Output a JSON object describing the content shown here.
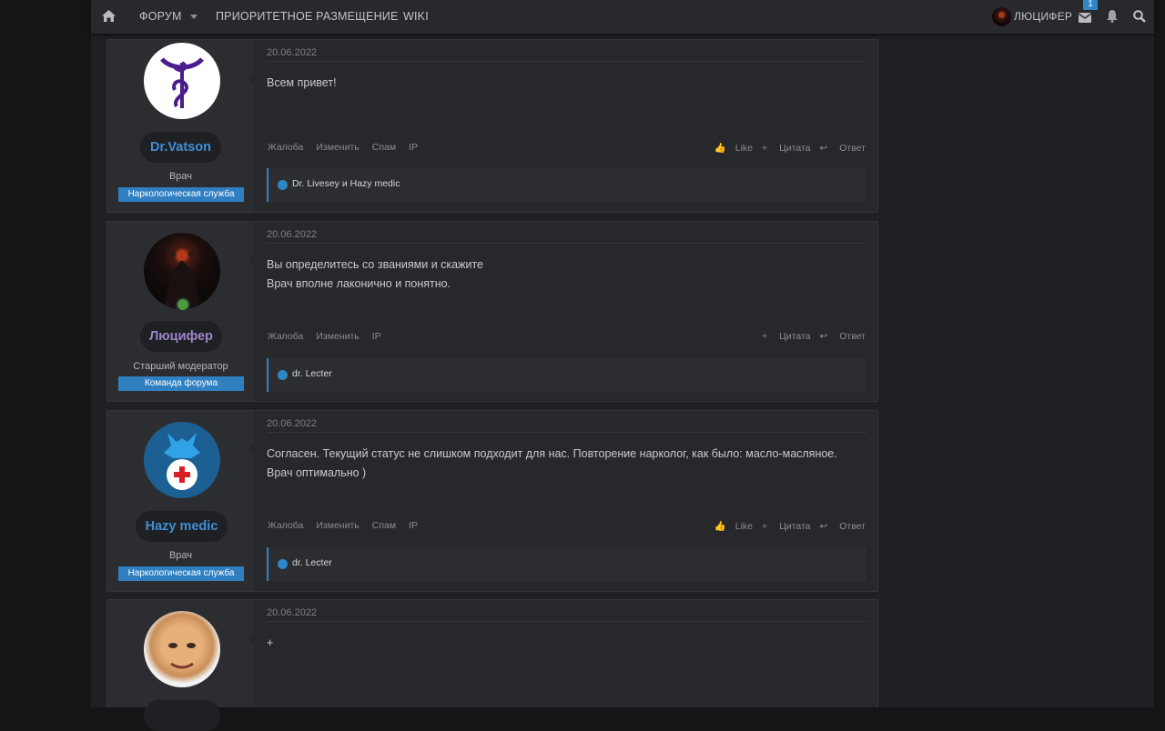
{
  "navbar": {
    "home_icon": "home-icon",
    "forum_label": "ФОРУМ",
    "priority_label": "ПРИОРИТЕТНОЕ РАЗМЕЩЕНИЕ",
    "wiki_label": "WIKI",
    "username": "ЛЮЦИФЕР",
    "messages_badge": "1",
    "icons": [
      "envelope-icon",
      "bell-icon",
      "search-icon"
    ]
  },
  "colors": {
    "accent": "#2f86c7",
    "drvatson_name": "#3f8fd6",
    "lucifer_name": "#9b85c9",
    "hazy_name": "#3f8fd6"
  },
  "posts": [
    {
      "date": "20.06.2022",
      "username": "Dr.Vatson",
      "user_title": "Врач",
      "banner": "Наркологическая служба",
      "body": [
        "Всем привет!"
      ],
      "actions": [
        "Жалоба",
        "Изменить",
        "Спам",
        "IP"
      ],
      "like": "Like",
      "quote": "Цитата",
      "reply": "Ответ",
      "reactions": "Dr. Livesey и Hazy medic"
    },
    {
      "date": "20.06.2022",
      "username": "Люцифер",
      "user_title": "Старший модератор",
      "banner": "Команда форума",
      "body": [
        "Вы определитесь со званиями и скажите",
        "Врач вполне лаконично и понятно."
      ],
      "actions": [
        "Жалоба",
        "Изменить",
        "IP"
      ],
      "quote": "Цитата",
      "reply": "Ответ",
      "reactions": "dr. Lecter"
    },
    {
      "date": "20.06.2022",
      "username": "Hazy medic",
      "user_title": "Врач",
      "banner": "Наркологическая служба",
      "body": [
        "Согласен. Текущий статус не слишком подходит для нас. Повторение нарколог, как было: масло-масляное. Врач оптимально )"
      ],
      "actions": [
        "Жалоба",
        "Изменить",
        "Спам",
        "IP"
      ],
      "like": "Like",
      "quote": "Цитата",
      "reply": "Ответ",
      "reactions": "dr. Lecter"
    },
    {
      "date": "20.06.2022",
      "body": [
        "+"
      ]
    }
  ]
}
